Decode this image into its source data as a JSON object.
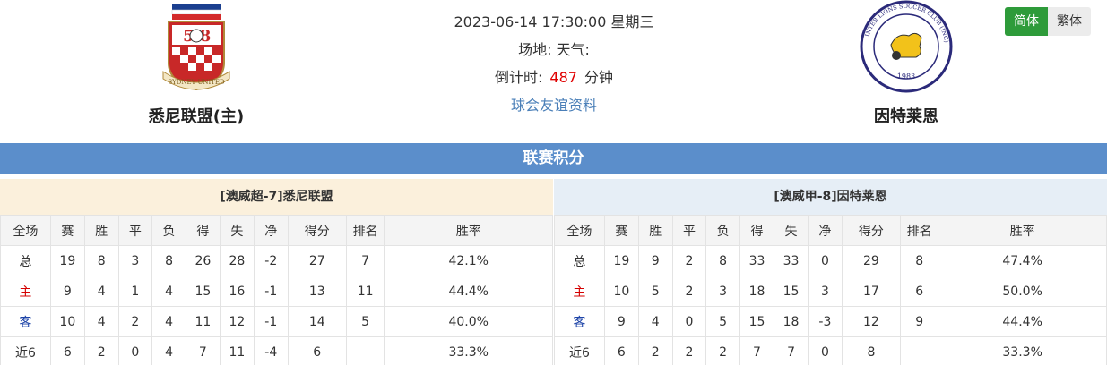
{
  "match": {
    "datetime": "2023-06-14 17:30:00 星期三",
    "venue_weather": "场地: 天气:",
    "countdown_label": "倒计时:",
    "countdown_value": "487",
    "countdown_unit": "分钟",
    "friendly_link": "球会友谊资料"
  },
  "home_team": {
    "name": "悉尼联盟(主)",
    "logo_text": "SYDNEY UNITED",
    "logo_numbers": "5 8"
  },
  "away_team": {
    "name": "因特莱恩",
    "logo_text": "INTER LIONS SOCCER CLUB (INC)",
    "logo_year": "1983"
  },
  "lang": {
    "simplified": "简体",
    "traditional": "繁体"
  },
  "section_title": "联赛积分",
  "columns": [
    "全场",
    "赛",
    "胜",
    "平",
    "负",
    "得",
    "失",
    "净",
    "得分",
    "排名",
    "胜率"
  ],
  "home_standings": {
    "title": "[澳威超-7]悉尼联盟",
    "rows": [
      {
        "label": "总",
        "vals": [
          "19",
          "8",
          "3",
          "8",
          "26",
          "28",
          "-2",
          "27",
          "7",
          "42.1%"
        ]
      },
      {
        "label": "主",
        "vals": [
          "9",
          "4",
          "1",
          "4",
          "15",
          "16",
          "-1",
          "13",
          "11",
          "44.4%"
        ]
      },
      {
        "label": "客",
        "vals": [
          "10",
          "4",
          "2",
          "4",
          "11",
          "12",
          "-1",
          "14",
          "5",
          "40.0%"
        ]
      },
      {
        "label": "近6",
        "vals": [
          "6",
          "2",
          "0",
          "4",
          "7",
          "11",
          "-4",
          "6",
          "",
          "33.3%"
        ]
      }
    ]
  },
  "away_standings": {
    "title": "[澳威甲-8]因特莱恩",
    "rows": [
      {
        "label": "总",
        "vals": [
          "19",
          "9",
          "2",
          "8",
          "33",
          "33",
          "0",
          "29",
          "8",
          "47.4%"
        ]
      },
      {
        "label": "主",
        "vals": [
          "10",
          "5",
          "2",
          "3",
          "18",
          "15",
          "3",
          "17",
          "6",
          "50.0%"
        ]
      },
      {
        "label": "客",
        "vals": [
          "9",
          "4",
          "0",
          "5",
          "15",
          "18",
          "-3",
          "12",
          "9",
          "44.4%"
        ]
      },
      {
        "label": "近6",
        "vals": [
          "6",
          "2",
          "2",
          "2",
          "7",
          "7",
          "0",
          "8",
          "",
          "33.3%"
        ]
      }
    ]
  },
  "colors": {
    "header_bar": "#5b8ecb",
    "home_head_bg": "#fbf0dc",
    "away_head_bg": "#e6eef6",
    "home_label": "#d40000",
    "away_label": "#1f45a8",
    "countdown": "#e00000",
    "lang_active": "#2e9b3a"
  }
}
